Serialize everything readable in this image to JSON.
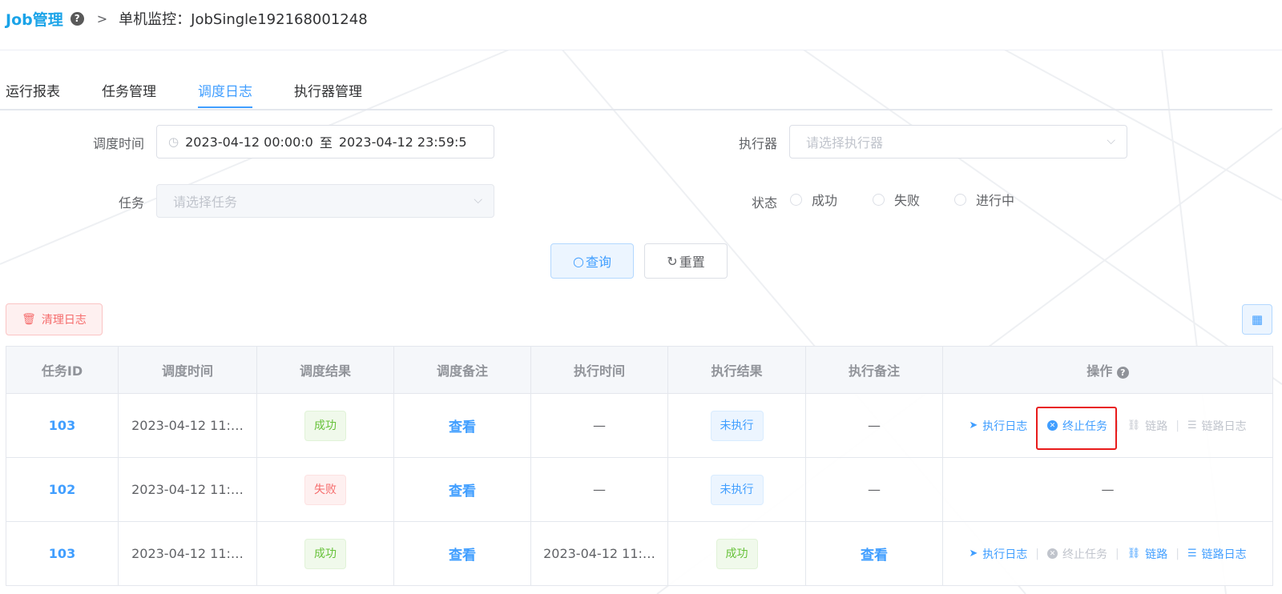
{
  "breadcrumb": {
    "root": "Job管理",
    "current": "单机监控：JobSingle192168001248"
  },
  "tabs": [
    "运行报表",
    "任务管理",
    "调度日志",
    "执行器管理"
  ],
  "form": {
    "schedule_time_label": "调度时间",
    "range_start": "2023-04-12 00:00:0",
    "range_sep": "至",
    "range_end": "2023-04-12 23:59:5",
    "executor_label": "执行器",
    "executor_placeholder": "请选择执行器",
    "task_label": "任务",
    "task_placeholder": "请选择任务",
    "status_label": "状态",
    "status_options": [
      "成功",
      "失败",
      "进行中"
    ],
    "query_button": "查询",
    "reset_button": "重置"
  },
  "toolbar": {
    "clear_log_button": "清理日志"
  },
  "table": {
    "headers": [
      "任务ID",
      "调度时间",
      "调度结果",
      "调度备注",
      "执行时间",
      "执行结果",
      "执行备注",
      "操作"
    ],
    "ops": {
      "exec_log": "执行日志",
      "stop_task": "终止任务",
      "trace": "链路",
      "trace_log": "链路日志"
    },
    "rows": [
      {
        "id": "103",
        "schedule_time": "2023-04-12 11:…",
        "schedule_result": "成功",
        "schedule_note": "查看",
        "exec_time": "—",
        "exec_result": "未执行",
        "exec_note": "—"
      },
      {
        "id": "102",
        "schedule_time": "2023-04-12 11:…",
        "schedule_result": "失败",
        "schedule_note": "查看",
        "exec_time": "—",
        "exec_result": "未执行",
        "exec_note": "—",
        "ops_text": "—"
      },
      {
        "id": "103",
        "schedule_time": "2023-04-12 11:…",
        "schedule_result": "成功",
        "schedule_note": "查看",
        "exec_time": "2023-04-12 11:…",
        "exec_result": "成功",
        "exec_note": "查看"
      }
    ]
  },
  "colors": {
    "primary": "#409eff",
    "success": "#67c23a",
    "danger": "#f56c6c",
    "highlight": "#e81b1b"
  }
}
